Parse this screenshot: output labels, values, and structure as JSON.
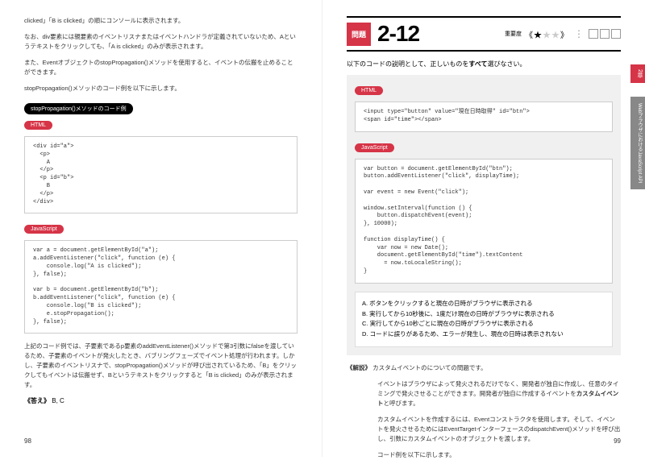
{
  "left": {
    "intro1": "clicked」「B is clicked」の順にコンソールに表示されます。",
    "intro2": "なお、div要素には親要素のイベントリスナまたはイベントハンドラが定義されていないため、Aというテキストをクリックしても、「A is clicked」のみが表示されます。",
    "intro3": "また、EventオブジェクトのstopPropagation()メソッドを使用すると、イベントの伝搬を止めることができます。",
    "intro4": "stopPropagation()メソッドのコード例を以下に示します。",
    "pillTitle": "stopPropagation()メソッドのコード例",
    "htmlLabel": "HTML",
    "jsLabel": "JavaScript",
    "htmlCode": "<div id=\"a\">\n  <p>\n    A\n  </p>\n  <p id=\"b\">\n    B\n  </p>\n</div>",
    "jsCode": "var a = document.getElementById(\"a\");\na.addEventListener(\"click\", function (e) {\n    console.log(\"A is clicked\");\n}, false);\n\nvar b = document.getElementById(\"b\");\nb.addEventListener(\"click\", function (e) {\n    console.log(\"B is clicked\");\n    e.stopPropagation();\n}, false);",
    "explain": "上記のコード例では、子要素であるp要素のaddEventListener()メソッドで第3引数にfalseを渡しているため、子要素のイベントが発火したとき、バブリングフェーズでイベント処理が行われます。しかし、子要素のイベントリスナで、stopPropagation()メソッドが呼び出されているため、「B」をクリックしてもイベントは伝搬せず、Bというテキストをクリックすると「B is clicked」のみが表示されます。",
    "answerLabel": "《答え》",
    "answerValue": "B, C",
    "pageNum": "98"
  },
  "right": {
    "mondaiTag": "問題",
    "mondaiNum": "2-12",
    "diffLabel": "重要度",
    "question": "以下のコードの説明として、正しいものをすべて選びなさい。",
    "htmlLabel": "HTML",
    "jsLabel": "JavaScript",
    "htmlCode": "<input type=\"button\" value=\"現在日時取得\" id=\"btn\">\n<span id=\"time\"></span>",
    "jsCode": "var button = document.getElementById(\"btn\");\nbutton.addEventListener(\"click\", displayTime);\n\nvar event = new Event(\"click\");\n\nwindow.setInterval(function () {\n    button.dispatchEvent(event);\n}, 10000);\n\nfunction displayTime() {\n    var now = new Date();\n    document.getElementById(\"time\").textContent\n      = now.toLocaleString();\n}",
    "optA": "A.  ボタンをクリックすると現在の日時がブラウザに表示される",
    "optB": "B.  実行してから10秒後に、1度だけ現在の日時がブラウザに表示される",
    "optC": "C.  実行してから10秒ごとに現在の日時がブラウザに表示される",
    "optD": "D.  コードに誤りがあるため、エラーが発生し、現在の日時は表示されない",
    "kaisetsuLabel": "《解説》",
    "kaisetsu1": "カスタムイベントのについての問題です。",
    "kaisetsu2": "イベントはブラウザによって発火されるだけでなく、開発者が独自に作成し、任意のタイミングで発火させることができます。開発者が独自に作成するイベントを",
    "kaisetsu2b": "カスタムイベント",
    "kaisetsu2c": "と呼びます。",
    "kaisetsu3": "カスタムイベントを作成するには、Eventコンストラクタを使用します。そして、イベントを発火させるためにはEventTargetインターフェースのdispatchEvent()メソッドを呼び出し、引数にカスタムイベントのオブジェクトを渡します。",
    "kaisetsu4": "コード例を以下に示します。",
    "sideTab1": "2章",
    "sideTab2": "WebブラウザにおけるJavaScript API",
    "pageNum": "99"
  }
}
